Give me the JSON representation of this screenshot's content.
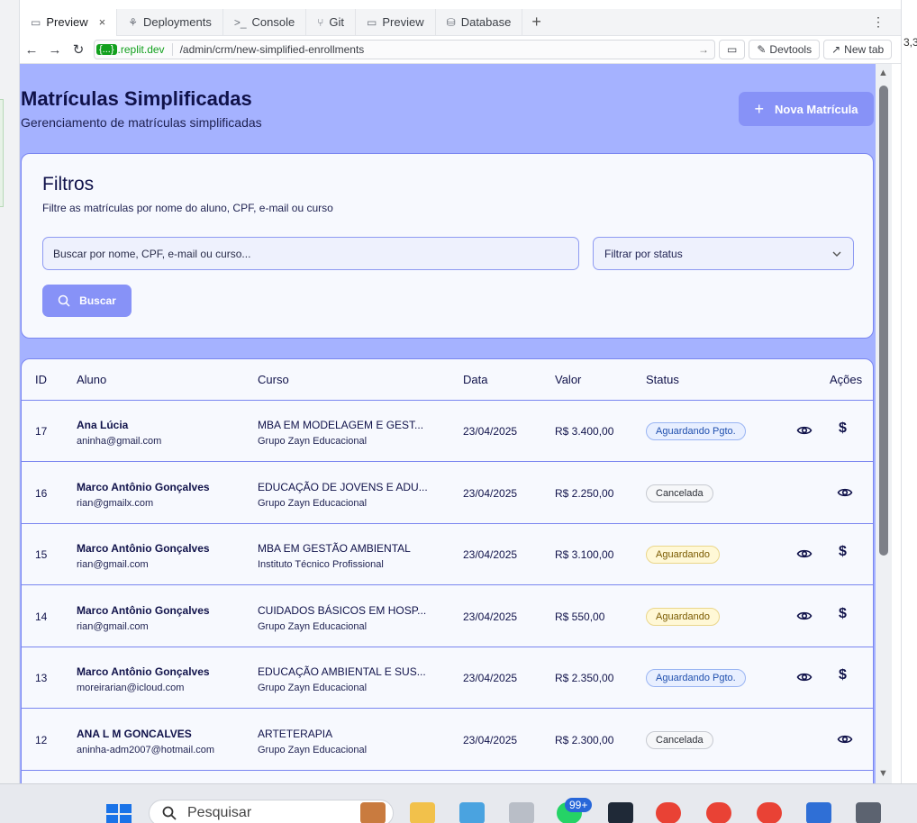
{
  "browser": {
    "tabs": [
      {
        "label": "Preview",
        "icon": "monitor-icon",
        "active": true
      },
      {
        "label": "Deployments",
        "icon": "deploy-icon",
        "active": false
      },
      {
        "label": "Console",
        "icon": "terminal-icon",
        "active": false
      },
      {
        "label": "Git",
        "icon": "git-icon",
        "active": false
      },
      {
        "label": "Preview",
        "icon": "monitor-icon",
        "active": false
      },
      {
        "label": "Database",
        "icon": "database-icon",
        "active": false
      }
    ],
    "url_badge": "{...}",
    "url_domain": ".replit.dev",
    "url_path": "/admin/crm/new-simplified-enrollments",
    "devtools_label": "Devtools",
    "newtab_label": "New tab",
    "right_number": "3,3"
  },
  "page": {
    "title": "Matrículas Simplificadas",
    "subtitle": "Gerenciamento de matrículas simplificadas",
    "new_button": "Nova Matrícula"
  },
  "filters": {
    "title": "Filtros",
    "description": "Filtre as matrículas por nome do aluno, CPF, e-mail ou curso",
    "search_placeholder": "Buscar por nome, CPF, e-mail ou curso...",
    "status_placeholder": "Filtrar por status",
    "search_button": "Buscar"
  },
  "table": {
    "headers": {
      "id": "ID",
      "student": "Aluno",
      "course": "Curso",
      "date": "Data",
      "value": "Valor",
      "status": "Status",
      "actions": "Ações"
    },
    "rows": [
      {
        "id": "17",
        "name": "Ana Lúcia",
        "email": "aninha@gmail.com",
        "course": "MBA EM MODELAGEM E GEST...",
        "institution": "Grupo Zayn Educacional",
        "date": "23/04/2025",
        "value": "R$ 3.400,00",
        "status": "Aguardando Pgto.",
        "status_color": "blue",
        "has_payment": true
      },
      {
        "id": "16",
        "name": "Marco Antônio Gonçalves",
        "email": "rian@gmailx.com",
        "course": "EDUCAÇÃO DE JOVENS E ADU...",
        "institution": "Grupo Zayn Educacional",
        "date": "23/04/2025",
        "value": "R$ 2.250,00",
        "status": "Cancelada",
        "status_color": "gray",
        "has_payment": false
      },
      {
        "id": "15",
        "name": "Marco Antônio Gonçalves",
        "email": "rian@gmail.com",
        "course": "MBA EM GESTÃO AMBIENTAL",
        "institution": "Instituto Técnico Profissional",
        "date": "23/04/2025",
        "value": "R$ 3.100,00",
        "status": "Aguardando",
        "status_color": "yellow",
        "has_payment": true
      },
      {
        "id": "14",
        "name": "Marco Antônio Gonçalves",
        "email": "rian@gmail.com",
        "course": "CUIDADOS BÁSICOS EM HOSP...",
        "institution": "Grupo Zayn Educacional",
        "date": "23/04/2025",
        "value": "R$ 550,00",
        "status": "Aguardando",
        "status_color": "yellow",
        "has_payment": true
      },
      {
        "id": "13",
        "name": "Marco Antônio Gonçalves",
        "email": "moreirarian@icloud.com",
        "course": "EDUCAÇÃO AMBIENTAL E SUS...",
        "institution": "Grupo Zayn Educacional",
        "date": "23/04/2025",
        "value": "R$ 2.350,00",
        "status": "Aguardando Pgto.",
        "status_color": "blue",
        "has_payment": true
      },
      {
        "id": "12",
        "name": "ANA L M GONCALVES",
        "email": "aninha-adm2007@hotmail.com",
        "course": "ARTETERAPIA",
        "institution": "Grupo Zayn Educacional",
        "date": "23/04/2025",
        "value": "R$ 2.300,00",
        "status": "Cancelada",
        "status_color": "gray",
        "has_payment": false
      }
    ]
  },
  "taskbar": {
    "search_placeholder": "Pesquisar",
    "notification_count": "99+"
  }
}
